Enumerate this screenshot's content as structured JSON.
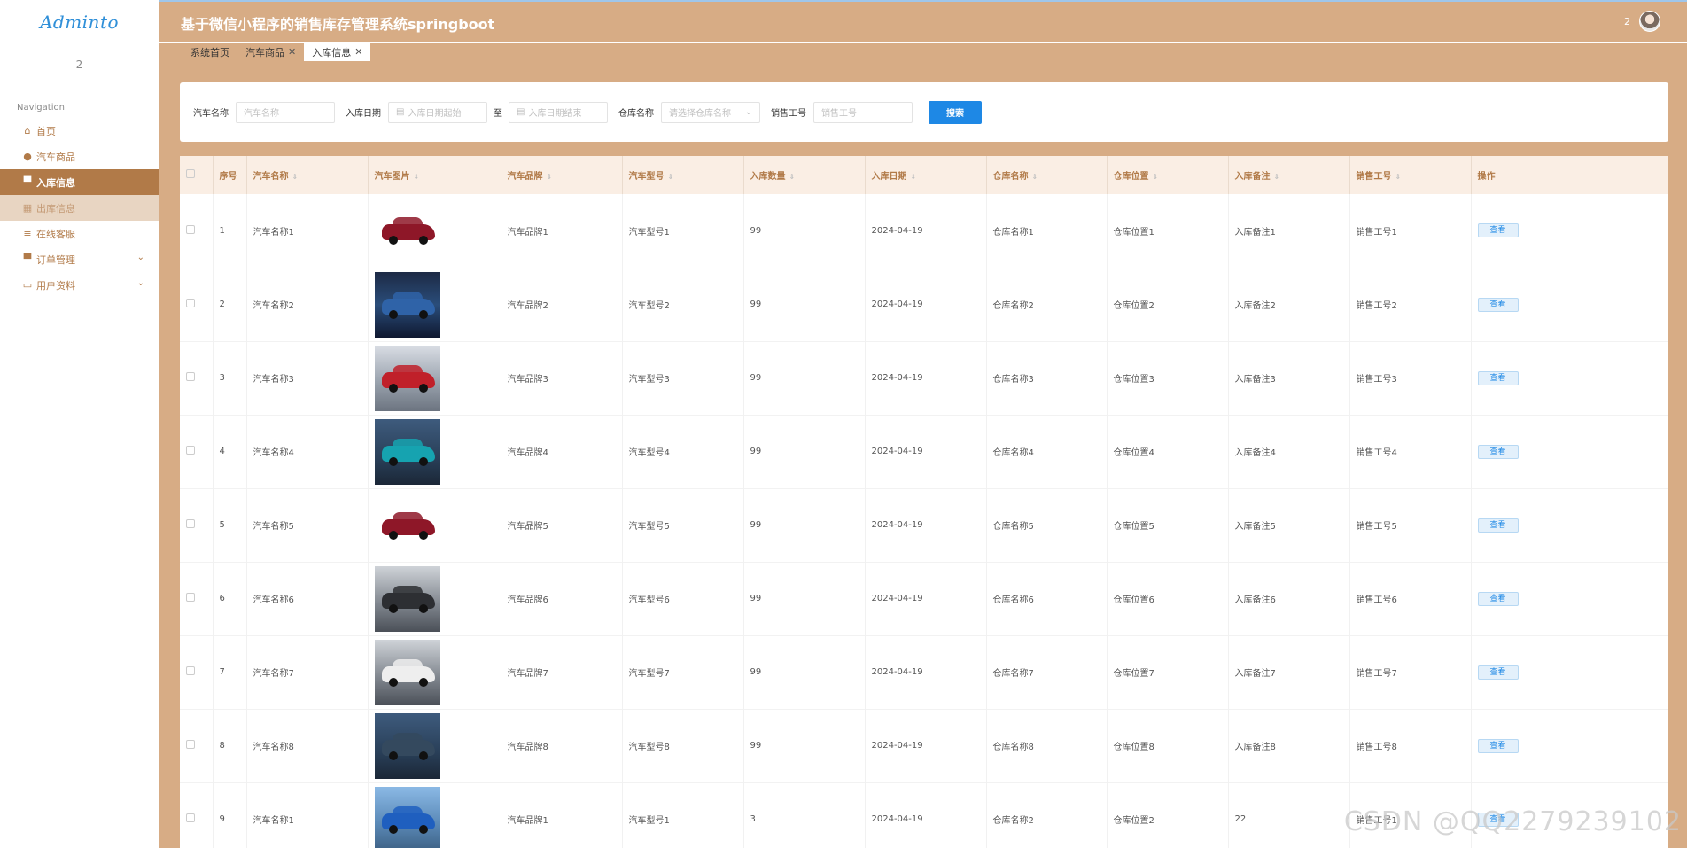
{
  "app": {
    "logo": "Adminto",
    "user_badge": "2",
    "title": "基于微信小程序的销售库存管理系统springboot",
    "top_user": "2"
  },
  "sidebar": {
    "nav_title": "Navigation",
    "items": [
      {
        "label": "首页",
        "icon": "home-icon"
      },
      {
        "label": "汽车商品",
        "icon": "user-icon"
      },
      {
        "label": "入库信息",
        "icon": "chat-icon",
        "active": true
      },
      {
        "label": "出库信息",
        "icon": "grid-icon"
      },
      {
        "label": "在线客服",
        "icon": "list-icon"
      },
      {
        "label": "订单管理",
        "icon": "monitor-icon",
        "expandable": true
      },
      {
        "label": "用户资料",
        "icon": "card-icon",
        "expandable": true
      }
    ]
  },
  "tabs": [
    {
      "label": "系统首页",
      "closable": false
    },
    {
      "label": "汽车商品",
      "closable": true
    },
    {
      "label": "入库信息",
      "closable": true,
      "active": true
    }
  ],
  "search": {
    "car_name_label": "汽车名称",
    "car_name_placeholder": "汽车名称",
    "date_label": "入库日期",
    "date_start_placeholder": "入库日期起始",
    "date_sep": "至",
    "date_end_placeholder": "入库日期结束",
    "warehouse_label": "仓库名称",
    "warehouse_placeholder": "请选择仓库名称",
    "sales_no_label": "销售工号",
    "sales_no_placeholder": "销售工号",
    "search_button": "搜索"
  },
  "table": {
    "columns": [
      "序号",
      "汽车名称",
      "汽车图片",
      "汽车品牌",
      "汽车型号",
      "入库数量",
      "入库日期",
      "仓库名称",
      "仓库位置",
      "入库备注",
      "销售工号",
      "操作"
    ],
    "action_label": "查看",
    "rows": [
      {
        "no": "1",
        "name": "汽车名称1",
        "brand": "汽车品牌1",
        "model": "汽车型号1",
        "qty": "99",
        "date": "2024-04-19",
        "wh": "仓库名称1",
        "loc": "仓库位置1",
        "note": "入库备注1",
        "sales": "销售工号1",
        "img": "bare",
        "paint": "#8e1728"
      },
      {
        "no": "2",
        "name": "汽车名称2",
        "brand": "汽车品牌2",
        "model": "汽车型号2",
        "qty": "99",
        "date": "2024-04-19",
        "wh": "仓库名称2",
        "loc": "仓库位置2",
        "note": "入库备注2",
        "sales": "销售工号2",
        "img": "blue",
        "paint": "#2f63a8"
      },
      {
        "no": "3",
        "name": "汽车名称3",
        "brand": "汽车品牌3",
        "model": "汽车型号3",
        "qty": "99",
        "date": "2024-04-19",
        "wh": "仓库名称3",
        "loc": "仓库位置3",
        "note": "入库备注3",
        "sales": "销售工号3",
        "img": "red",
        "paint": "#c0202a"
      },
      {
        "no": "4",
        "name": "汽车名称4",
        "brand": "汽车品牌4",
        "model": "汽车型号4",
        "qty": "99",
        "date": "2024-04-19",
        "wh": "仓库名称4",
        "loc": "仓库位置4",
        "note": "入库备注4",
        "sales": "销售工号4",
        "img": "night",
        "paint": "#16a3b0"
      },
      {
        "no": "5",
        "name": "汽车名称5",
        "brand": "汽车品牌5",
        "model": "汽车型号5",
        "qty": "99",
        "date": "2024-04-19",
        "wh": "仓库名称5",
        "loc": "仓库位置5",
        "note": "入库备注5",
        "sales": "销售工号5",
        "img": "bare",
        "paint": "#8e1728"
      },
      {
        "no": "6",
        "name": "汽车名称6",
        "brand": "汽车品牌6",
        "model": "汽车型号6",
        "qty": "99",
        "date": "2024-04-19",
        "wh": "仓库名称6",
        "loc": "仓库位置6",
        "note": "入库备注6",
        "sales": "销售工号6",
        "img": "grey",
        "paint": "#2d2f33"
      },
      {
        "no": "7",
        "name": "汽车名称7",
        "brand": "汽车品牌7",
        "model": "汽车型号7",
        "qty": "99",
        "date": "2024-04-19",
        "wh": "仓库名称7",
        "loc": "仓库位置7",
        "note": "入库备注7",
        "sales": "销售工号7",
        "img": "grey",
        "paint": "#eeeeee"
      },
      {
        "no": "8",
        "name": "汽车名称8",
        "brand": "汽车品牌8",
        "model": "汽车型号8",
        "qty": "99",
        "date": "2024-04-19",
        "wh": "仓库名称8",
        "loc": "仓库位置8",
        "note": "入库备注8",
        "sales": "销售工号8",
        "img": "night",
        "paint": "#34495e"
      },
      {
        "no": "9",
        "name": "汽车名称1",
        "brand": "汽车品牌1",
        "model": "汽车型号1",
        "qty": "3",
        "date": "2024-04-19",
        "wh": "仓库名称2",
        "loc": "仓库位置2",
        "note": "22",
        "sales": "销售工号1",
        "img": "sky",
        "paint": "#1f5fbf"
      }
    ]
  },
  "watermark": "CSDN @QQ2279239102",
  "colors": {
    "accent": "#b17a48",
    "header_bg": "#d7ac85",
    "primary_button": "#1e88e5"
  }
}
